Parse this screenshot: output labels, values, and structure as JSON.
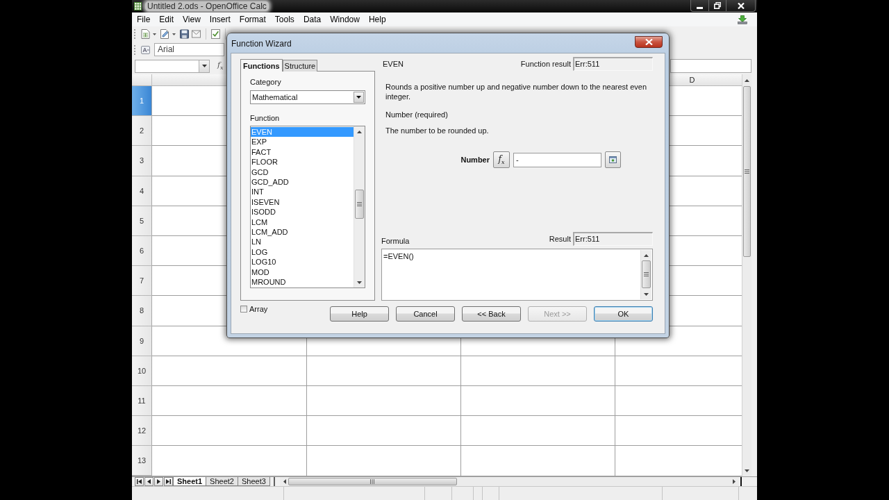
{
  "window": {
    "title": "Untitled 2.ods - OpenOffice Calc"
  },
  "menu": [
    "File",
    "Edit",
    "View",
    "Insert",
    "Format",
    "Tools",
    "Data",
    "Window",
    "Help"
  ],
  "formatting_toolbar": {
    "font_name": "Arial"
  },
  "formula_bar": {
    "function_wizard": "f$_{x}$"
  },
  "sheet": {
    "column_header": "D",
    "rows": [
      {
        "label": "1",
        "selected": true
      },
      {
        "label": "2",
        "selected": false
      },
      {
        "label": "3",
        "selected": false
      },
      {
        "label": "4",
        "selected": false
      },
      {
        "label": "5",
        "selected": false
      },
      {
        "label": "6",
        "selected": false
      },
      {
        "label": "7",
        "selected": false
      },
      {
        "label": "8",
        "selected": false
      },
      {
        "label": "9",
        "selected": false
      },
      {
        "label": "10",
        "selected": false
      },
      {
        "label": "11",
        "selected": false
      },
      {
        "label": "12",
        "selected": false
      },
      {
        "label": "13",
        "selected": false
      }
    ]
  },
  "sheet_tabs": [
    {
      "label": "Sheet1",
      "selected": true
    },
    {
      "label": "Sheet2",
      "selected": false
    },
    {
      "label": "Sheet3",
      "selected": false
    }
  ],
  "dialog": {
    "title": "Function Wizard",
    "tabs": [
      {
        "label": "Functions",
        "selected": true
      },
      {
        "label": "Structure",
        "selected": false
      }
    ],
    "category": {
      "label": "Category",
      "value": "Mathematical"
    },
    "function_list": {
      "label": "Function",
      "items": [
        {
          "label": "EVEN",
          "selected": true
        },
        {
          "label": "EXP",
          "selected": false
        },
        {
          "label": "FACT",
          "selected": false
        },
        {
          "label": "FLOOR",
          "selected": false
        },
        {
          "label": "GCD",
          "selected": false
        },
        {
          "label": "GCD_ADD",
          "selected": false
        },
        {
          "label": "INT",
          "selected": false
        },
        {
          "label": "ISEVEN",
          "selected": false
        },
        {
          "label": "ISODD",
          "selected": false
        },
        {
          "label": "LCM",
          "selected": false
        },
        {
          "label": "LCM_ADD",
          "selected": false
        },
        {
          "label": "LN",
          "selected": false
        },
        {
          "label": "LOG",
          "selected": false
        },
        {
          "label": "LOG10",
          "selected": false
        },
        {
          "label": "MOD",
          "selected": false
        },
        {
          "label": "MROUND",
          "selected": false
        }
      ]
    },
    "array": {
      "label": "Array",
      "checked": false
    },
    "function_name": "EVEN",
    "function_result": {
      "label": "Function result",
      "value": "Err:511"
    },
    "description": "Rounds a positive number up and negative number down to the nearest even integer.",
    "argument_heading": "Number (required)",
    "argument_description": "The number to be rounded up.",
    "argument": {
      "label": "Number",
      "function_button": "f$_{x}$",
      "value": "-"
    },
    "formula": {
      "label": "Formula",
      "value": "=EVEN()"
    },
    "result": {
      "label": "Result",
      "value": "Err:511"
    },
    "buttons": [
      {
        "label": "Help",
        "disabled": false,
        "default": false
      },
      {
        "label": "Cancel",
        "disabled": false,
        "default": false
      },
      {
        "label": "<< Back",
        "disabled": false,
        "default": false
      },
      {
        "label": "Next >>",
        "disabled": true,
        "default": false
      },
      {
        "label": "OK",
        "disabled": false,
        "default": true
      }
    ]
  }
}
